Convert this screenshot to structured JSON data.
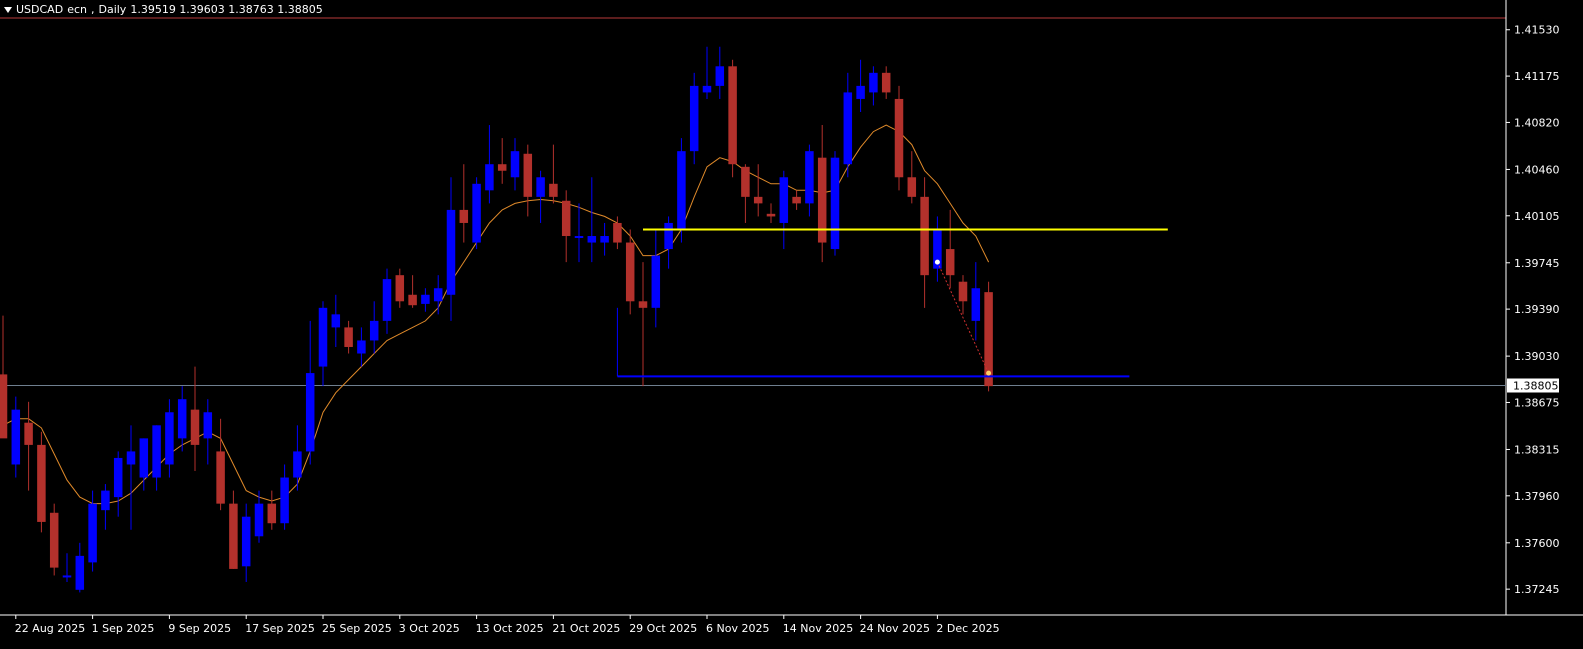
{
  "header": {
    "symbol": "USDCAD",
    "account": "ecn",
    "timeframe": "Daily",
    "ohlc": "1.39519 1.39603 1.38763 1.38805"
  },
  "colors": {
    "background": "#000000",
    "bull": "#0000ff",
    "bear": "#b3312c",
    "ma": "#e08a2a",
    "resistance": "#ffff00",
    "support": "#0000ff",
    "price_line": "#6f7f8f",
    "top_line": "#b83a3a",
    "axis_text": "#ffffff"
  },
  "chart_data": {
    "type": "candlestick",
    "symbol": "USDCAD",
    "timeframe": "Daily",
    "ylim": [
      1.3707,
      1.4162
    ],
    "y_ticks": [
      "1.41530",
      "1.41175",
      "1.40820",
      "1.40460",
      "1.40105",
      "1.39745",
      "1.39390",
      "1.39030",
      "1.38675",
      "1.38315",
      "1.37960",
      "1.37600",
      "1.37245"
    ],
    "x_ticks": [
      {
        "index": 1,
        "label": "22 Aug 2025"
      },
      {
        "index": 7,
        "label": "1 Sep 2025"
      },
      {
        "index": 13,
        "label": "9 Sep 2025"
      },
      {
        "index": 19,
        "label": "17 Sep 2025"
      },
      {
        "index": 25,
        "label": "25 Sep 2025"
      },
      {
        "index": 31,
        "label": "3 Oct 2025"
      },
      {
        "index": 37,
        "label": "13 Oct 2025"
      },
      {
        "index": 43,
        "label": "21 Oct 2025"
      },
      {
        "index": 49,
        "label": "29 Oct 2025"
      },
      {
        "index": 55,
        "label": "6 Nov 2025"
      },
      {
        "index": 61,
        "label": "14 Nov 2025"
      },
      {
        "index": 67,
        "label": "24 Nov 2025"
      },
      {
        "index": 73,
        "label": "2 Dec 2025"
      }
    ],
    "current_price": "1.38805",
    "candles": [
      {
        "o": 1.3889,
        "h": 1.3934,
        "l": 1.386,
        "c": 1.384
      },
      {
        "o": 1.382,
        "h": 1.3872,
        "l": 1.381,
        "c": 1.3862
      },
      {
        "o": 1.3852,
        "h": 1.3868,
        "l": 1.38,
        "c": 1.3835
      },
      {
        "o": 1.3835,
        "h": 1.3845,
        "l": 1.3768,
        "c": 1.3776
      },
      {
        "o": 1.3783,
        "h": 1.379,
        "l": 1.3735,
        "c": 1.3741
      },
      {
        "o": 1.3735,
        "h": 1.3752,
        "l": 1.373,
        "c": 1.3735
      },
      {
        "o": 1.3724,
        "h": 1.376,
        "l": 1.3722,
        "c": 1.375
      },
      {
        "o": 1.3745,
        "h": 1.38,
        "l": 1.3738,
        "c": 1.379
      },
      {
        "o": 1.3785,
        "h": 1.3805,
        "l": 1.377,
        "c": 1.38
      },
      {
        "o": 1.3795,
        "h": 1.383,
        "l": 1.378,
        "c": 1.3825
      },
      {
        "o": 1.382,
        "h": 1.385,
        "l": 1.377,
        "c": 1.383
      },
      {
        "o": 1.381,
        "h": 1.384,
        "l": 1.38,
        "c": 1.384
      },
      {
        "o": 1.381,
        "h": 1.385,
        "l": 1.38,
        "c": 1.385
      },
      {
        "o": 1.382,
        "h": 1.387,
        "l": 1.381,
        "c": 1.386
      },
      {
        "o": 1.384,
        "h": 1.388,
        "l": 1.383,
        "c": 1.387
      },
      {
        "o": 1.3862,
        "h": 1.3895,
        "l": 1.3815,
        "c": 1.3835
      },
      {
        "o": 1.384,
        "h": 1.387,
        "l": 1.382,
        "c": 1.386
      },
      {
        "o": 1.383,
        "h": 1.3855,
        "l": 1.3785,
        "c": 1.379
      },
      {
        "o": 1.379,
        "h": 1.38,
        "l": 1.374,
        "c": 1.374
      },
      {
        "o": 1.3742,
        "h": 1.379,
        "l": 1.373,
        "c": 1.378
      },
      {
        "o": 1.3765,
        "h": 1.38,
        "l": 1.376,
        "c": 1.379
      },
      {
        "o": 1.379,
        "h": 1.38,
        "l": 1.377,
        "c": 1.3775
      },
      {
        "o": 1.3775,
        "h": 1.382,
        "l": 1.377,
        "c": 1.381
      },
      {
        "o": 1.381,
        "h": 1.385,
        "l": 1.38,
        "c": 1.383
      },
      {
        "o": 1.383,
        "h": 1.393,
        "l": 1.382,
        "c": 1.389
      },
      {
        "o": 1.3895,
        "h": 1.3945,
        "l": 1.388,
        "c": 1.394
      },
      {
        "o": 1.3925,
        "h": 1.395,
        "l": 1.391,
        "c": 1.3935
      },
      {
        "o": 1.3925,
        "h": 1.393,
        "l": 1.3905,
        "c": 1.391
      },
      {
        "o": 1.3905,
        "h": 1.3925,
        "l": 1.3895,
        "c": 1.3915
      },
      {
        "o": 1.3915,
        "h": 1.3945,
        "l": 1.3905,
        "c": 1.393
      },
      {
        "o": 1.393,
        "h": 1.397,
        "l": 1.392,
        "c": 1.3962
      },
      {
        "o": 1.3965,
        "h": 1.397,
        "l": 1.394,
        "c": 1.3945
      },
      {
        "o": 1.395,
        "h": 1.3965,
        "l": 1.394,
        "c": 1.3942
      },
      {
        "o": 1.3943,
        "h": 1.3955,
        "l": 1.3937,
        "c": 1.395
      },
      {
        "o": 1.3945,
        "h": 1.3965,
        "l": 1.3935,
        "c": 1.3955
      },
      {
        "o": 1.395,
        "h": 1.404,
        "l": 1.393,
        "c": 1.4015
      },
      {
        "o": 1.4015,
        "h": 1.405,
        "l": 1.399,
        "c": 1.4005
      },
      {
        "o": 1.399,
        "h": 1.404,
        "l": 1.3985,
        "c": 1.4035
      },
      {
        "o": 1.403,
        "h": 1.408,
        "l": 1.402,
        "c": 1.405
      },
      {
        "o": 1.405,
        "h": 1.407,
        "l": 1.4035,
        "c": 1.4045
      },
      {
        "o": 1.404,
        "h": 1.407,
        "l": 1.403,
        "c": 1.406
      },
      {
        "o": 1.4058,
        "h": 1.4065,
        "l": 1.401,
        "c": 1.4025
      },
      {
        "o": 1.4025,
        "h": 1.4045,
        "l": 1.4005,
        "c": 1.404
      },
      {
        "o": 1.4035,
        "h": 1.4065,
        "l": 1.402,
        "c": 1.4025
      },
      {
        "o": 1.4022,
        "h": 1.403,
        "l": 1.3975,
        "c": 1.3995
      },
      {
        "o": 1.3995,
        "h": 1.402,
        "l": 1.3975,
        "c": 1.3995
      },
      {
        "o": 1.399,
        "h": 1.404,
        "l": 1.3975,
        "c": 1.3995
      },
      {
        "o": 1.399,
        "h": 1.4005,
        "l": 1.398,
        "c": 1.3995
      },
      {
        "o": 1.4005,
        "h": 1.401,
        "l": 1.3985,
        "c": 1.399
      },
      {
        "o": 1.399,
        "h": 1.4,
        "l": 1.3935,
        "c": 1.3945
      },
      {
        "o": 1.3945,
        "h": 1.3975,
        "l": 1.388,
        "c": 1.394
      },
      {
        "o": 1.394,
        "h": 1.4,
        "l": 1.3925,
        "c": 1.398
      },
      {
        "o": 1.3985,
        "h": 1.401,
        "l": 1.397,
        "c": 1.4005
      },
      {
        "o": 1.4,
        "h": 1.407,
        "l": 1.399,
        "c": 1.406
      },
      {
        "o": 1.406,
        "h": 1.412,
        "l": 1.405,
        "c": 1.411
      },
      {
        "o": 1.4105,
        "h": 1.414,
        "l": 1.41,
        "c": 1.411
      },
      {
        "o": 1.411,
        "h": 1.414,
        "l": 1.41,
        "c": 1.4125
      },
      {
        "o": 1.4125,
        "h": 1.413,
        "l": 1.404,
        "c": 1.405
      },
      {
        "o": 1.4048,
        "h": 1.405,
        "l": 1.4005,
        "c": 1.4025
      },
      {
        "o": 1.4025,
        "h": 1.405,
        "l": 1.401,
        "c": 1.402
      },
      {
        "o": 1.4012,
        "h": 1.402,
        "l": 1.4005,
        "c": 1.401
      },
      {
        "o": 1.4005,
        "h": 1.4045,
        "l": 1.3985,
        "c": 1.404
      },
      {
        "o": 1.4025,
        "h": 1.403,
        "l": 1.4015,
        "c": 1.402
      },
      {
        "o": 1.402,
        "h": 1.4065,
        "l": 1.401,
        "c": 1.406
      },
      {
        "o": 1.4055,
        "h": 1.408,
        "l": 1.3975,
        "c": 1.399
      },
      {
        "o": 1.3985,
        "h": 1.406,
        "l": 1.398,
        "c": 1.4055
      },
      {
        "o": 1.405,
        "h": 1.412,
        "l": 1.404,
        "c": 1.4105
      },
      {
        "o": 1.41,
        "h": 1.413,
        "l": 1.409,
        "c": 1.411
      },
      {
        "o": 1.4105,
        "h": 1.4125,
        "l": 1.4095,
        "c": 1.412
      },
      {
        "o": 1.412,
        "h": 1.4125,
        "l": 1.41,
        "c": 1.4105
      },
      {
        "o": 1.41,
        "h": 1.411,
        "l": 1.403,
        "c": 1.404
      },
      {
        "o": 1.404,
        "h": 1.406,
        "l": 1.402,
        "c": 1.4025
      },
      {
        "o": 1.4025,
        "h": 1.404,
        "l": 1.394,
        "c": 1.3965
      },
      {
        "o": 1.397,
        "h": 1.401,
        "l": 1.396,
        "c": 1.4
      },
      {
        "o": 1.3985,
        "h": 1.4015,
        "l": 1.3955,
        "c": 1.3965
      },
      {
        "o": 1.396,
        "h": 1.3965,
        "l": 1.3935,
        "c": 1.3945
      },
      {
        "o": 1.393,
        "h": 1.3975,
        "l": 1.3915,
        "c": 1.3955
      },
      {
        "o": 1.3952,
        "h": 1.396,
        "l": 1.3876,
        "c": 1.388
      }
    ],
    "moving_average": [
      1.385,
      1.3855,
      1.3855,
      1.3848,
      1.3828,
      1.3808,
      1.3795,
      1.379,
      1.379,
      1.3792,
      1.3798,
      1.3808,
      1.3818,
      1.3828,
      1.3835,
      1.384,
      1.3845,
      1.384,
      1.382,
      1.38,
      1.3795,
      1.3792,
      1.3795,
      1.3805,
      1.383,
      1.386,
      1.3875,
      1.3885,
      1.3895,
      1.3905,
      1.3915,
      1.392,
      1.3925,
      1.393,
      1.394,
      1.396,
      1.3975,
      1.399,
      1.4005,
      1.4015,
      1.402,
      1.4022,
      1.4023,
      1.4022,
      1.402,
      1.4017,
      1.4013,
      1.401,
      1.4005,
      1.3995,
      1.398,
      1.398,
      1.3985,
      1.4,
      1.4025,
      1.4048,
      1.4055,
      1.4052,
      1.4045,
      1.404,
      1.4035,
      1.4035,
      1.403,
      1.403,
      1.4028,
      1.403,
      1.4048,
      1.4063,
      1.4075,
      1.408,
      1.4075,
      1.4065,
      1.4045,
      1.4035,
      1.402,
      1.4005,
      1.3995,
      1.3975
    ],
    "resistance_level": {
      "price": 1.4,
      "start_index": 50,
      "end_index": 91
    },
    "support_level": {
      "price": 1.38875,
      "start_index": 48,
      "end_index": 88
    }
  }
}
